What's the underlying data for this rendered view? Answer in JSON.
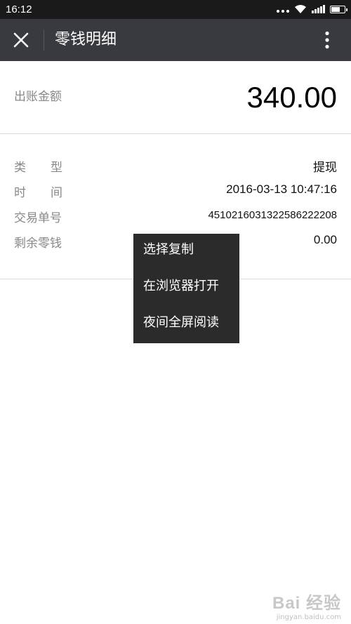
{
  "status_bar": {
    "time": "16:12",
    "icons": [
      "dots-icon",
      "wifi-icon",
      "signal-icon",
      "battery-icon"
    ]
  },
  "header": {
    "title": "零钱明细",
    "close_icon": "close-icon",
    "more_icon": "more-vertical-icon",
    "background": "#393a3f"
  },
  "summary": {
    "label": "出账金额",
    "amount": "340.00"
  },
  "details": [
    {
      "label": "类型",
      "value": "提现"
    },
    {
      "label": "时间",
      "value": "2016-03-13 10:47:16"
    },
    {
      "label": "交易单号",
      "value": "4510216031322586222208"
    },
    {
      "label": "剩余零钱",
      "value": "0.00"
    }
  ],
  "context_menu": {
    "items": [
      "选择复制",
      "在浏览器打开",
      "夜间全屏阅读"
    ],
    "background": "#2b2b2b"
  },
  "watermark": {
    "logo": "Bai 经验",
    "url": "jingyan.baidu.com"
  }
}
